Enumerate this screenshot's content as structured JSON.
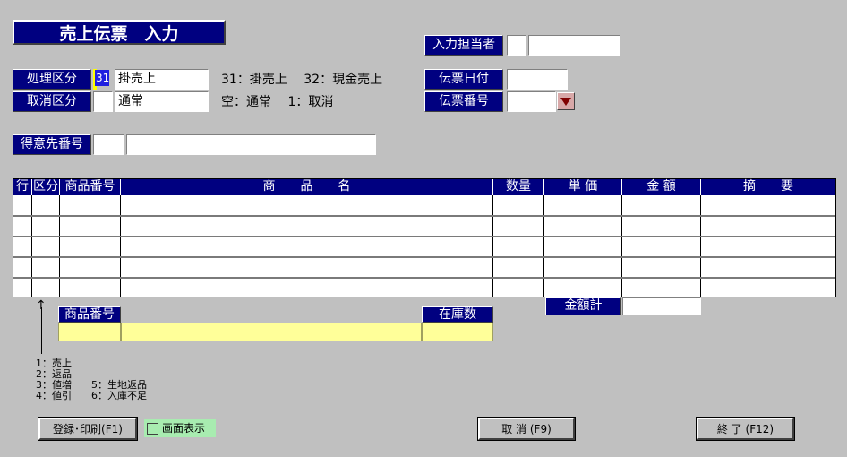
{
  "title": "売上伝票　入力",
  "input_person": {
    "label": "入力担当者",
    "code": "",
    "name": ""
  },
  "processing": {
    "label": "処理区分",
    "code": "31",
    "value": "掛売上",
    "hint": "31：掛売上　 32：現金売上"
  },
  "cancel": {
    "label": "取消区分",
    "code": "",
    "value": "通常",
    "hint": "空：通常　 1：取消"
  },
  "slip_date": {
    "label": "伝票日付",
    "value": ""
  },
  "slip_number": {
    "label": "伝票番号",
    "value": ""
  },
  "customer": {
    "label": "得意先番号",
    "code": "",
    "name": ""
  },
  "table": {
    "headers": [
      "行",
      "区分",
      "商品番号",
      "商　　品　　名",
      "数量",
      "単 価",
      "金 額",
      "摘　　要"
    ],
    "rows": [
      [
        "",
        "",
        "",
        "",
        "",
        "",
        "",
        ""
      ],
      [
        "",
        "",
        "",
        "",
        "",
        "",
        "",
        ""
      ],
      [
        "",
        "",
        "",
        "",
        "",
        "",
        "",
        ""
      ],
      [
        "",
        "",
        "",
        "",
        "",
        "",
        "",
        ""
      ],
      [
        "",
        "",
        "",
        "",
        "",
        "",
        "",
        ""
      ]
    ]
  },
  "total": {
    "label": "金額計",
    "value": ""
  },
  "lookup": {
    "product_label": "商品番号",
    "stock_label": "在庫数",
    "product_code": "",
    "product_name": "",
    "stock": ""
  },
  "arrow_glyph": "↑",
  "legend": [
    "1：売上",
    "2：返品",
    "3：値増　　5：生地返品",
    "4：値引　　6：入庫不足"
  ],
  "buttons": {
    "register_print": "登録･印刷(F1)",
    "screen_display": "画面表示",
    "cancel": "取 消 (F9)",
    "exit": "終 了 (F12)"
  }
}
